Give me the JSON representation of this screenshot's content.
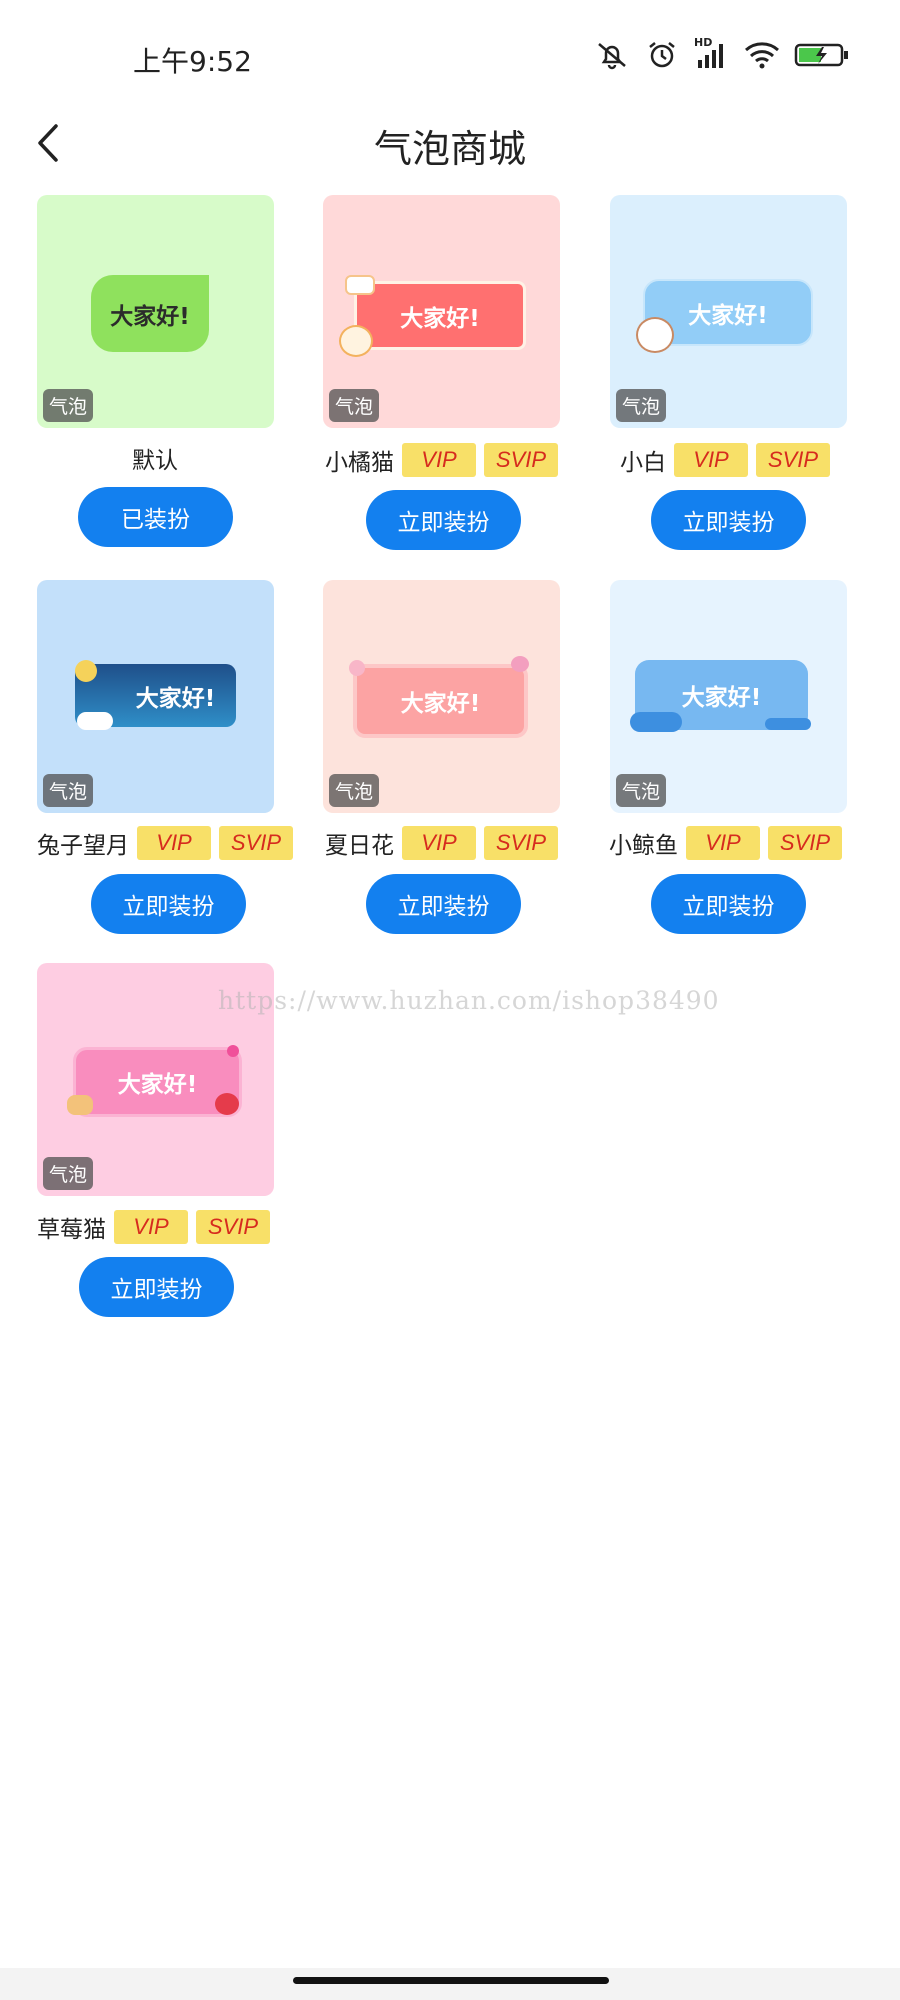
{
  "status": {
    "time": "上午9:52",
    "hd_label": "HD"
  },
  "header": {
    "title": "气泡商城"
  },
  "bubble_text": "大家好!",
  "tag_label": "气泡",
  "badges": {
    "vip": "VIP",
    "svip": "SVIP"
  },
  "items": [
    {
      "name": "默认",
      "button": "已装扮",
      "has_badges": false,
      "bg": "#d7fbc9",
      "bubble_bg": "#8fe15d",
      "bubble_color": "#2b2b2b"
    },
    {
      "name": "小橘猫",
      "button": "立即装扮",
      "has_badges": true,
      "bg": "#ffd9d9",
      "bubble_bg": "#ff7070",
      "bubble_color": "#ffffff"
    },
    {
      "name": "小白",
      "button": "立即装扮",
      "has_badges": true,
      "bg": "#dbeffd",
      "bubble_bg": "#92cdf7",
      "bubble_color": "#ffffff"
    },
    {
      "name": "兔子望月",
      "button": "立即装扮",
      "has_badges": true,
      "bg": "#c3e0fa",
      "bubble_bg": "#1f5c9a",
      "bubble_color": "#ffffff"
    },
    {
      "name": "夏日花",
      "button": "立即装扮",
      "has_badges": true,
      "bg": "#fde3dc",
      "bubble_bg": "#fca3a3",
      "bubble_color": "#ffffff"
    },
    {
      "name": "小鲸鱼",
      "button": "立即装扮",
      "has_badges": true,
      "bg": "#e6f3fe",
      "bubble_bg": "#77b8f1",
      "bubble_color": "#ffffff"
    },
    {
      "name": "草莓猫",
      "button": "立即装扮",
      "has_badges": true,
      "bg": "#fecde2",
      "bubble_bg": "#f98dbe",
      "bubble_color": "#ffffff"
    }
  ],
  "watermark": "https://www.huzhan.com/ishop38490",
  "colors": {
    "button": "#1380ef",
    "badge_bg": "#f8e068",
    "badge_text": "#d62b1e"
  }
}
